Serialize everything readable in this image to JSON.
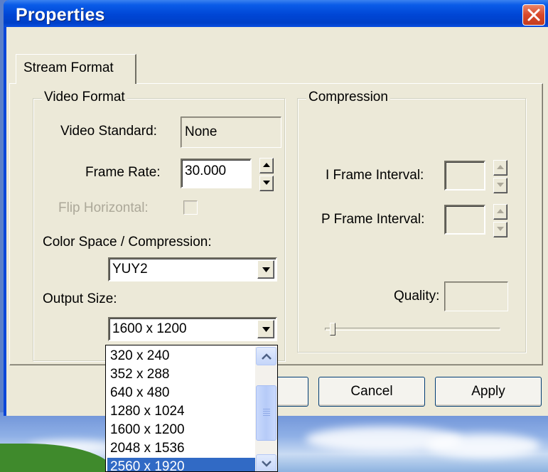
{
  "window": {
    "title": "Properties"
  },
  "tabs": [
    {
      "label": "Stream Format"
    }
  ],
  "video_format": {
    "group_title": "Video Format",
    "video_standard_label": "Video Standard:",
    "video_standard_value": "None",
    "frame_rate_label": "Frame Rate:",
    "frame_rate_value": "30.000",
    "flip_horizontal_label": "Flip Horizontal:",
    "flip_horizontal_checked": false,
    "color_space_label": "Color Space / Compression:",
    "color_space_value": "YUY2",
    "output_size_label": "Output Size:",
    "output_size_value": "1600 x 1200"
  },
  "compression": {
    "group_title": "Compression",
    "i_frame_label": "I Frame Interval:",
    "i_frame_value": "",
    "p_frame_label": "P Frame Interval:",
    "p_frame_value": "",
    "quality_label": "Quality:",
    "quality_value": ""
  },
  "dropdown": {
    "options": [
      "320 x 240",
      "352 x 288",
      "640 x 480",
      "1280 x 1024",
      "1600 x 1200",
      "2048 x 1536",
      "2560 x 1920"
    ],
    "highlighted": "2560 x 1920"
  },
  "buttons": {
    "cancel": "Cancel",
    "apply": "Apply"
  },
  "icons": {
    "close": "close-icon",
    "spin_up": "arrow-up-icon",
    "spin_down": "arrow-down-icon",
    "combo": "chevron-down-icon",
    "scroll_up": "scroll-up-icon",
    "scroll_down": "scroll-down-icon"
  },
  "colors": {
    "titlebar": "#0046d5",
    "selection": "#316ac5",
    "close": "#d8482a",
    "dialog": "#ece9d8"
  }
}
